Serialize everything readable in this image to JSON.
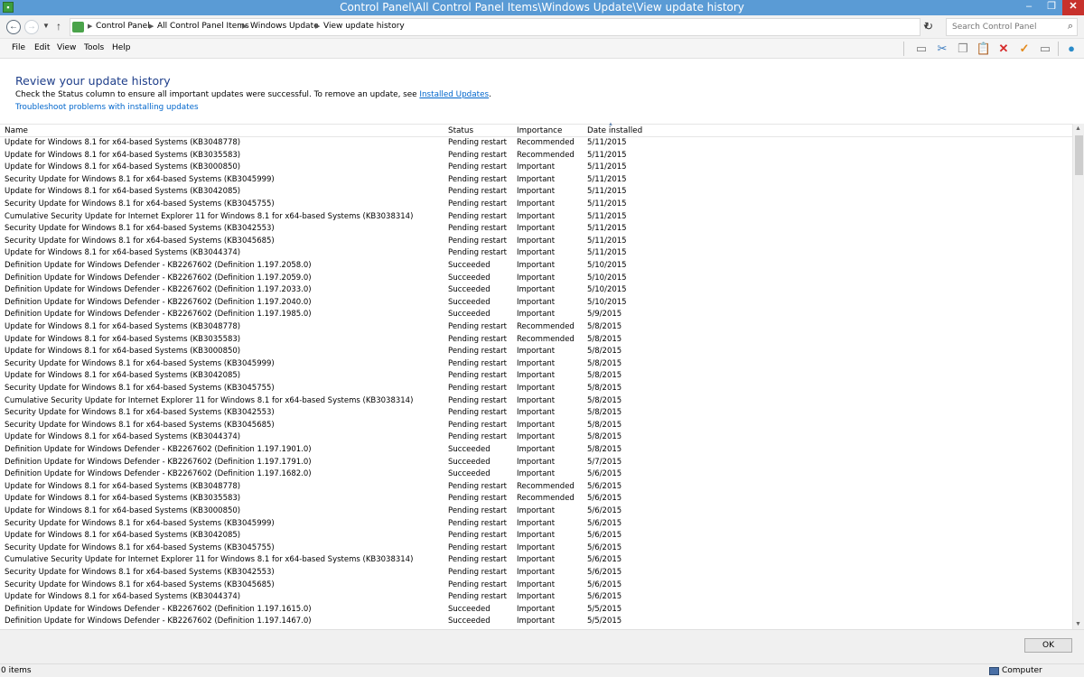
{
  "window": {
    "title": "Control Panel\\All Control Panel Items\\Windows Update\\View update history"
  },
  "address": {
    "crumbs": [
      "Control Panel",
      "All Control Panel Items",
      "Windows Update",
      "View update history"
    ],
    "search_placeholder": "Search Control Panel"
  },
  "menu": {
    "file": "File",
    "edit": "Edit",
    "view": "View",
    "tools": "Tools",
    "help": "Help"
  },
  "header": {
    "title": "Review your update history",
    "description": "Check the Status column to ensure all important updates were successful. To remove an update, see ",
    "installed_updates_link": "Installed Updates",
    "description_end": ".",
    "troubleshoot_link": "Troubleshoot problems with installing updates"
  },
  "list": {
    "columns": {
      "name": "Name",
      "status": "Status",
      "importance": "Importance",
      "date": "Date installed"
    },
    "rows": [
      [
        "Update for Windows 8.1 for x64-based Systems (KB3048778)",
        "Pending restart",
        "Recommended",
        "5/11/2015"
      ],
      [
        "Update for Windows 8.1 for x64-based Systems (KB3035583)",
        "Pending restart",
        "Recommended",
        "5/11/2015"
      ],
      [
        "Update for Windows 8.1 for x64-based Systems (KB3000850)",
        "Pending restart",
        "Important",
        "5/11/2015"
      ],
      [
        "Security Update for Windows 8.1 for x64-based Systems (KB3045999)",
        "Pending restart",
        "Important",
        "5/11/2015"
      ],
      [
        "Update for Windows 8.1 for x64-based Systems (KB3042085)",
        "Pending restart",
        "Important",
        "5/11/2015"
      ],
      [
        "Security Update for Windows 8.1 for x64-based Systems (KB3045755)",
        "Pending restart",
        "Important",
        "5/11/2015"
      ],
      [
        "Cumulative Security Update for Internet Explorer 11 for Windows 8.1 for x64-based Systems (KB3038314)",
        "Pending restart",
        "Important",
        "5/11/2015"
      ],
      [
        "Security Update for Windows 8.1 for x64-based Systems (KB3042553)",
        "Pending restart",
        "Important",
        "5/11/2015"
      ],
      [
        "Security Update for Windows 8.1 for x64-based Systems (KB3045685)",
        "Pending restart",
        "Important",
        "5/11/2015"
      ],
      [
        "Update for Windows 8.1 for x64-based Systems (KB3044374)",
        "Pending restart",
        "Important",
        "5/11/2015"
      ],
      [
        "Definition Update for Windows Defender - KB2267602 (Definition 1.197.2058.0)",
        "Succeeded",
        "Important",
        "5/10/2015"
      ],
      [
        "Definition Update for Windows Defender - KB2267602 (Definition 1.197.2059.0)",
        "Succeeded",
        "Important",
        "5/10/2015"
      ],
      [
        "Definition Update for Windows Defender - KB2267602 (Definition 1.197.2033.0)",
        "Succeeded",
        "Important",
        "5/10/2015"
      ],
      [
        "Definition Update for Windows Defender - KB2267602 (Definition 1.197.2040.0)",
        "Succeeded",
        "Important",
        "5/10/2015"
      ],
      [
        "Definition Update for Windows Defender - KB2267602 (Definition 1.197.1985.0)",
        "Succeeded",
        "Important",
        "5/9/2015"
      ],
      [
        "Update for Windows 8.1 for x64-based Systems (KB3048778)",
        "Pending restart",
        "Recommended",
        "5/8/2015"
      ],
      [
        "Update for Windows 8.1 for x64-based Systems (KB3035583)",
        "Pending restart",
        "Recommended",
        "5/8/2015"
      ],
      [
        "Update for Windows 8.1 for x64-based Systems (KB3000850)",
        "Pending restart",
        "Important",
        "5/8/2015"
      ],
      [
        "Security Update for Windows 8.1 for x64-based Systems (KB3045999)",
        "Pending restart",
        "Important",
        "5/8/2015"
      ],
      [
        "Update for Windows 8.1 for x64-based Systems (KB3042085)",
        "Pending restart",
        "Important",
        "5/8/2015"
      ],
      [
        "Security Update for Windows 8.1 for x64-based Systems (KB3045755)",
        "Pending restart",
        "Important",
        "5/8/2015"
      ],
      [
        "Cumulative Security Update for Internet Explorer 11 for Windows 8.1 for x64-based Systems (KB3038314)",
        "Pending restart",
        "Important",
        "5/8/2015"
      ],
      [
        "Security Update for Windows 8.1 for x64-based Systems (KB3042553)",
        "Pending restart",
        "Important",
        "5/8/2015"
      ],
      [
        "Security Update for Windows 8.1 for x64-based Systems (KB3045685)",
        "Pending restart",
        "Important",
        "5/8/2015"
      ],
      [
        "Update for Windows 8.1 for x64-based Systems (KB3044374)",
        "Pending restart",
        "Important",
        "5/8/2015"
      ],
      [
        "Definition Update for Windows Defender - KB2267602 (Definition 1.197.1901.0)",
        "Succeeded",
        "Important",
        "5/8/2015"
      ],
      [
        "Definition Update for Windows Defender - KB2267602 (Definition 1.197.1791.0)",
        "Succeeded",
        "Important",
        "5/7/2015"
      ],
      [
        "Definition Update for Windows Defender - KB2267602 (Definition 1.197.1682.0)",
        "Succeeded",
        "Important",
        "5/6/2015"
      ],
      [
        "Update for Windows 8.1 for x64-based Systems (KB3048778)",
        "Pending restart",
        "Recommended",
        "5/6/2015"
      ],
      [
        "Update for Windows 8.1 for x64-based Systems (KB3035583)",
        "Pending restart",
        "Recommended",
        "5/6/2015"
      ],
      [
        "Update for Windows 8.1 for x64-based Systems (KB3000850)",
        "Pending restart",
        "Important",
        "5/6/2015"
      ],
      [
        "Security Update for Windows 8.1 for x64-based Systems (KB3045999)",
        "Pending restart",
        "Important",
        "5/6/2015"
      ],
      [
        "Update for Windows 8.1 for x64-based Systems (KB3042085)",
        "Pending restart",
        "Important",
        "5/6/2015"
      ],
      [
        "Security Update for Windows 8.1 for x64-based Systems (KB3045755)",
        "Pending restart",
        "Important",
        "5/6/2015"
      ],
      [
        "Cumulative Security Update for Internet Explorer 11 for Windows 8.1 for x64-based Systems (KB3038314)",
        "Pending restart",
        "Important",
        "5/6/2015"
      ],
      [
        "Security Update for Windows 8.1 for x64-based Systems (KB3042553)",
        "Pending restart",
        "Important",
        "5/6/2015"
      ],
      [
        "Security Update for Windows 8.1 for x64-based Systems (KB3045685)",
        "Pending restart",
        "Important",
        "5/6/2015"
      ],
      [
        "Update for Windows 8.1 for x64-based Systems (KB3044374)",
        "Pending restart",
        "Important",
        "5/6/2015"
      ],
      [
        "Definition Update for Windows Defender - KB2267602 (Definition 1.197.1615.0)",
        "Succeeded",
        "Important",
        "5/5/2015"
      ],
      [
        "Definition Update for Windows Defender - KB2267602 (Definition 1.197.1467.0)",
        "Succeeded",
        "Important",
        "5/5/2015"
      ]
    ]
  },
  "buttons": {
    "ok": "OK"
  },
  "status": {
    "items": "0 items",
    "location": "Computer"
  },
  "colors": {
    "titlebar": "#5a9bd5",
    "heading": "#1e3e8a",
    "link": "#0066cc",
    "close_button": "#c7312c"
  },
  "icons": {
    "app": "control-panel-icon",
    "toolbar": [
      "layout-icon",
      "cut-icon",
      "copy-icon",
      "paste-icon",
      "delete-icon",
      "check-icon",
      "properties-icon",
      "globe-icon"
    ]
  }
}
